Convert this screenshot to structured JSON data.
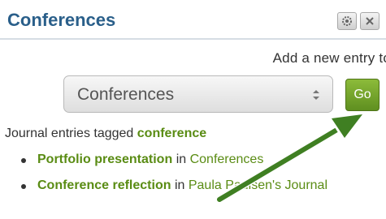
{
  "block": {
    "title": "Conferences",
    "configure_icon": "configure-icon",
    "close_icon": "close-icon"
  },
  "add_entry": {
    "label": "Add a new entry to"
  },
  "journal_select": {
    "selected": "Conferences"
  },
  "go_button": {
    "label": "Go"
  },
  "tagged": {
    "prefix": "Journal entries tagged",
    "tag": "conference"
  },
  "entries": [
    {
      "title": "Portfolio presentation",
      "in_word": "in",
      "journal": "Conferences"
    },
    {
      "title": "Conference reflection",
      "in_word": "in",
      "journal": "Paula Paulsen's Journal"
    }
  ],
  "annotation": {
    "arrow_color": "#3f7f22",
    "points_to": "go-button"
  },
  "colors": {
    "title": "#2a5f8a",
    "link_green": "#5a8c14",
    "go_button": "#7aa82d"
  }
}
